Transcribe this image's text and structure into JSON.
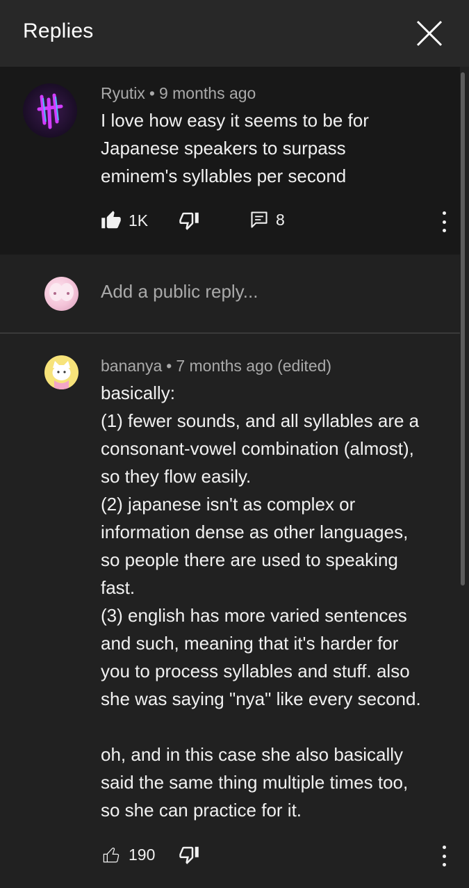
{
  "header": {
    "title": "Replies"
  },
  "parent": {
    "author": "Ryutix",
    "time": "9 months ago",
    "text": "I love how easy it seems to be for\nJapanese speakers to surpass\neminem's syllables per second",
    "likes": "1K",
    "replies": "8"
  },
  "reply_box": {
    "placeholder": "Add a public reply..."
  },
  "reply": {
    "author": "bananya",
    "time": "7 months ago (edited)",
    "text": "basically:\n(1) fewer sounds, and all syllables are a\nconsonant-vowel combination (almost),\nso they flow easily.\n(2) japanese isn't as complex or\ninformation dense as other languages,\nso people there are used to speaking\nfast.\n(3) english has more varied sentences\nand such, meaning that it's harder for\nyou to process syllables and stuff. also\nshe was saying \"nya\" like every second.\n\noh, and in this case she also basically\nsaid the same thing multiple times too,\nso she can practice for it.",
    "likes": "190"
  },
  "icons": {
    "close": "close-icon",
    "like": "thumbs-up-icon",
    "dislike": "thumbs-down-icon",
    "comments": "comment-icon",
    "more": "more-vert-icon"
  },
  "colors": {
    "background": "#212121",
    "header": "#282828",
    "highlight": "#181818",
    "secondary_text": "#aaaaaa",
    "primary_text": "#f1f1f1"
  }
}
